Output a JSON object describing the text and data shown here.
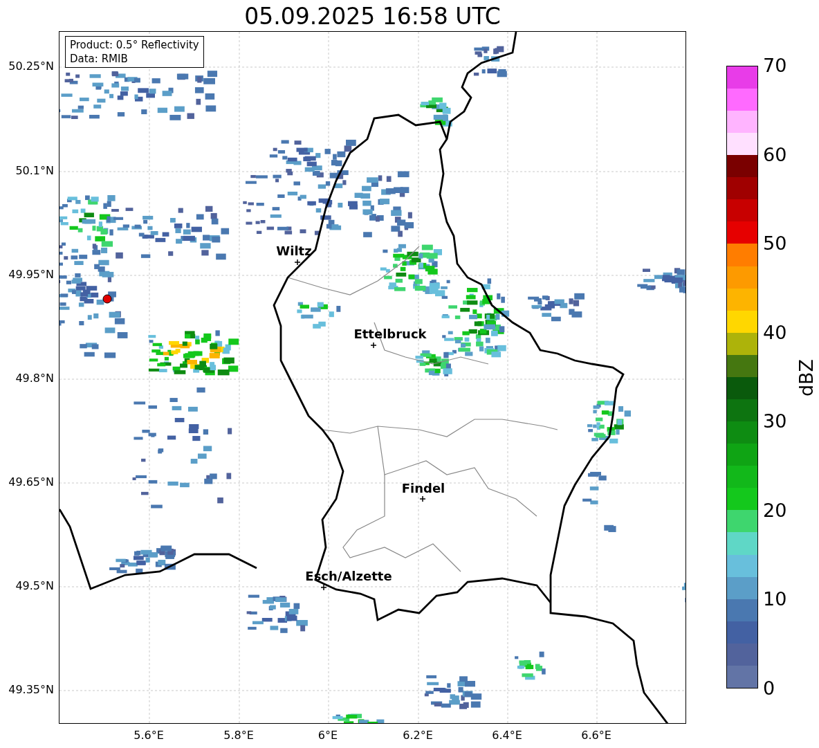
{
  "title": "05.09.2025 16:58 UTC",
  "info_box": [
    "Product: 0.5° Reflectivity",
    "Data: RMIB"
  ],
  "y_ticks": [
    "50.25°N",
    "50.1°N",
    "49.95°N",
    "49.8°N",
    "49.65°N",
    "49.5°N",
    "49.35°N"
  ],
  "x_ticks": [
    "5.6°E",
    "5.8°E",
    "6°E",
    "6.2°E",
    "6.4°E",
    "6.6°E"
  ],
  "cities": [
    {
      "name": "Wiltz"
    },
    {
      "name": "Ettelbruck"
    },
    {
      "name": "Findel"
    },
    {
      "name": "Esch/Alzette"
    }
  ],
  "colorbar": {
    "label": "dBZ",
    "ticks": [
      "70",
      "60",
      "50",
      "40",
      "30",
      "20",
      "10",
      "0"
    ],
    "segments": [
      {
        "color": "#6274a6"
      },
      {
        "color": "#52639c"
      },
      {
        "color": "#4361a3"
      },
      {
        "color": "#4a78b0"
      },
      {
        "color": "#5b9ec8"
      },
      {
        "color": "#68bfdc"
      },
      {
        "color": "#5fd7c6"
      },
      {
        "color": "#3ed66e"
      },
      {
        "color": "#14c81c"
      },
      {
        "color": "#12b81a"
      },
      {
        "color": "#0fa414"
      },
      {
        "color": "#0e8c12"
      },
      {
        "color": "#0d7410"
      },
      {
        "color": "#0a5a0c"
      },
      {
        "color": "#457710"
      },
      {
        "color": "#adb30a"
      },
      {
        "color": "#ffd700"
      },
      {
        "color": "#fdb400"
      },
      {
        "color": "#fd9a00"
      },
      {
        "color": "#ff7d00"
      },
      {
        "color": "#e60000"
      },
      {
        "color": "#c80000"
      },
      {
        "color": "#a00000"
      },
      {
        "color": "#7a0000"
      },
      {
        "color": "#ffe0ff"
      },
      {
        "color": "#ffb4ff"
      },
      {
        "color": "#ff6aff"
      },
      {
        "color": "#e83ce8"
      }
    ]
  }
}
